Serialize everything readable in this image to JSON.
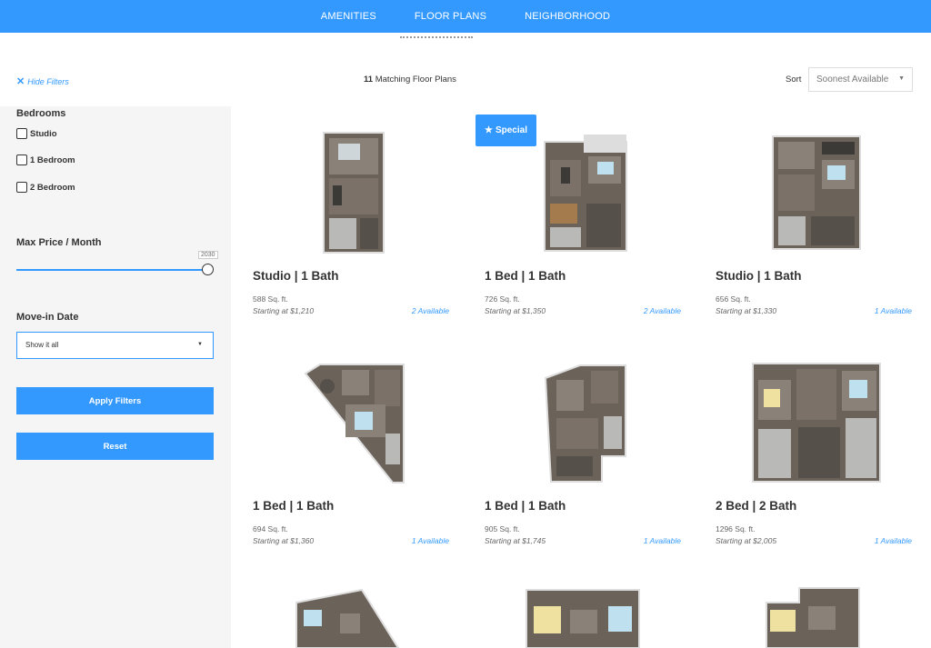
{
  "nav": {
    "items": [
      "AMENITIES",
      "FLOOR PLANS",
      "NEIGHBORHOOD"
    ]
  },
  "toolbar": {
    "hide_filters_label": "Hide Filters",
    "matching_count": "11",
    "matching_label": "Matching Floor Plans",
    "sort_label": "Sort",
    "sort_value": "Soonest Available"
  },
  "filters": {
    "bedrooms_heading": "Bedrooms",
    "bedroom_options": [
      "Studio",
      "1 Bedroom",
      "2 Bedroom"
    ],
    "max_price_heading": "Max Price / Month",
    "max_price_value": "2030",
    "max_price_fraction": 1.0,
    "movein_heading": "Move-in Date",
    "movein_value": "Show it all",
    "apply_label": "Apply Filters",
    "reset_label": "Reset"
  },
  "special_badge": "Special",
  "colors": {
    "accent": "#3399ff",
    "sidebar_bg": "#f5f5f5"
  },
  "plans": [
    {
      "title": "Studio | 1 Bath",
      "sqft": "588 Sq. ft.",
      "price": "Starting at $1,210",
      "available": "2 Available",
      "special": false
    },
    {
      "title": "1 Bed | 1 Bath",
      "sqft": "726 Sq. ft.",
      "price": "Starting at $1,350",
      "available": "2 Available",
      "special": true
    },
    {
      "title": "Studio | 1 Bath",
      "sqft": "656 Sq. ft.",
      "price": "Starting at $1,330",
      "available": "1 Available",
      "special": false
    },
    {
      "title": "1 Bed | 1 Bath",
      "sqft": "694 Sq. ft.",
      "price": "Starting at $1,360",
      "available": "1 Available",
      "special": false
    },
    {
      "title": "1 Bed | 1 Bath",
      "sqft": "905 Sq. ft.",
      "price": "Starting at $1,745",
      "available": "1 Available",
      "special": false
    },
    {
      "title": "2 Bed | 2 Bath",
      "sqft": "1296 Sq. ft.",
      "price": "Starting at $2,005",
      "available": "1 Available",
      "special": false
    }
  ]
}
